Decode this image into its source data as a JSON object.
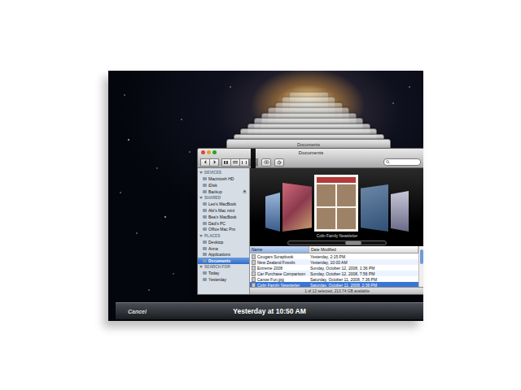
{
  "window": {
    "title": "Documents"
  },
  "stacked_windows": [
    {
      "title": "Documents"
    }
  ],
  "sidebar": {
    "sections": [
      {
        "header": "DEVICES",
        "items": [
          {
            "label": "Macintosh HD",
            "selected": false,
            "ejectable": false
          },
          {
            "label": "iDisk",
            "selected": false,
            "ejectable": false
          },
          {
            "label": "Backup",
            "selected": false,
            "ejectable": true
          }
        ]
      },
      {
        "header": "SHARED",
        "items": [
          {
            "label": "Leo's MacBook",
            "selected": false,
            "ejectable": false
          },
          {
            "label": "Abi's Mac mini",
            "selected": false,
            "ejectable": false
          },
          {
            "label": "Bea's MacBook",
            "selected": false,
            "ejectable": false
          },
          {
            "label": "Dad's PC",
            "selected": false,
            "ejectable": false
          },
          {
            "label": "Office Mac Pro",
            "selected": false,
            "ejectable": false
          }
        ]
      },
      {
        "header": "PLACES",
        "items": [
          {
            "label": "Desktop",
            "selected": false,
            "ejectable": false
          },
          {
            "label": "Anna",
            "selected": false,
            "ejectable": false
          },
          {
            "label": "Applications",
            "selected": false,
            "ejectable": false
          },
          {
            "label": "Documents",
            "selected": true,
            "ejectable": false
          }
        ]
      },
      {
        "header": "SEARCH FOR",
        "items": [
          {
            "label": "Today",
            "selected": false,
            "ejectable": false
          },
          {
            "label": "Yesterday",
            "selected": false,
            "ejectable": false
          }
        ]
      }
    ]
  },
  "cover_flow": {
    "caption": "Colin Family Newsletter"
  },
  "table": {
    "columns": [
      {
        "label": "Name",
        "sorted": true
      },
      {
        "label": "Date Modified",
        "sorted": false
      }
    ],
    "rows": [
      {
        "name": "Cougars Scrapbook",
        "date": "Yesterday, 2:15 PM",
        "selected": false
      },
      {
        "name": "New Zealand Fossils",
        "date": "Yesterday, 10:00 AM",
        "selected": false
      },
      {
        "name": "Extreme 2008",
        "date": "Sunday, October 12, 2008, 1:36 PM",
        "selected": false
      },
      {
        "name": "Car Purchase Comparison",
        "date": "Sunday, October 12, 2008, 7:56 PM",
        "selected": false
      },
      {
        "name": "Canoe Fun.jpg",
        "date": "Saturday, October 11, 2008, 7:36 PM",
        "selected": false
      },
      {
        "name": "Colin Family Newsletter",
        "date": "Saturday, October 11, 2008, 2:36 PM",
        "selected": true
      }
    ]
  },
  "status_bar": "1 of 12 selected, 213.74 GB available",
  "timeline": {
    "cancel": "Cancel",
    "date": "Yesterday at 10:50 AM"
  }
}
